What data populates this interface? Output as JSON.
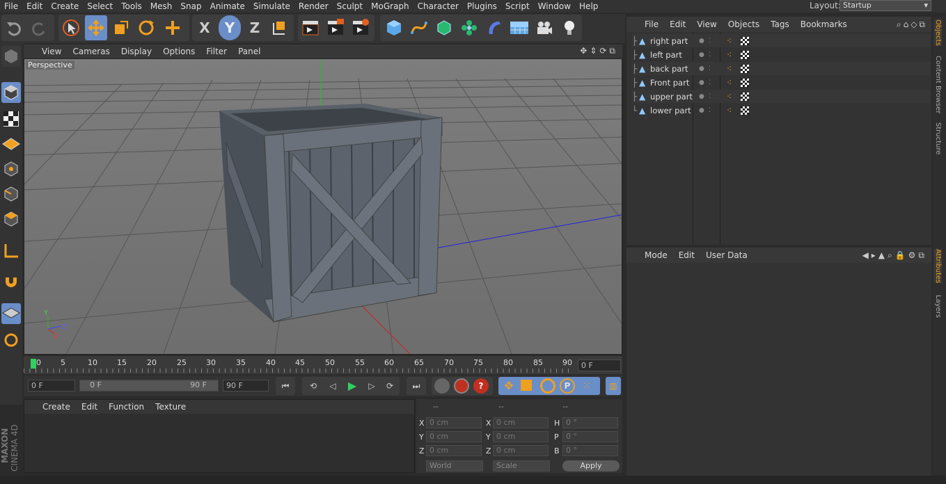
{
  "menubar": {
    "items": [
      "File",
      "Edit",
      "Create",
      "Select",
      "Tools",
      "Mesh",
      "Snap",
      "Animate",
      "Simulate",
      "Render",
      "Sculpt",
      "MoGraph",
      "Character",
      "Plugins",
      "Script",
      "Window",
      "Help"
    ],
    "layout_label": "Layout:",
    "layout_value": "Startup"
  },
  "toolbar": {
    "axis_x": "X",
    "axis_y": "Y",
    "axis_z": "Z"
  },
  "viewport": {
    "menu": [
      "View",
      "Cameras",
      "Display",
      "Options",
      "Filter",
      "Panel"
    ],
    "label": "Perspective",
    "axis_y": "Y",
    "axis_z": "Z",
    "axis_x": "X"
  },
  "timeline": {
    "ticks": [
      "0",
      "5",
      "10",
      "15",
      "20",
      "25",
      "30",
      "35",
      "40",
      "45",
      "50",
      "55",
      "60",
      "65",
      "70",
      "75",
      "80",
      "85",
      "90"
    ],
    "current_frame": "0 F"
  },
  "transport": {
    "start_field": "0 F",
    "range_start": "0 F",
    "range_end": "90 F",
    "end_field": "90 F"
  },
  "material_manager": {
    "menu": [
      "Create",
      "Edit",
      "Function",
      "Texture"
    ]
  },
  "coordinates": {
    "headers": [
      "--",
      "--",
      "--"
    ],
    "rows": [
      {
        "l1": "X",
        "v1": "0 cm",
        "l2": "X",
        "v2": "0 cm",
        "l3": "H",
        "v3": "0 °"
      },
      {
        "l1": "Y",
        "v1": "0 cm",
        "l2": "Y",
        "v2": "0 cm",
        "l3": "P",
        "v3": "0 °"
      },
      {
        "l1": "Z",
        "v1": "0 cm",
        "l2": "Z",
        "v2": "0 cm",
        "l3": "B",
        "v3": "0 °"
      }
    ],
    "world_select": "World",
    "scale_select": "Scale",
    "apply_label": "Apply"
  },
  "object_manager": {
    "menu": [
      "File",
      "Edit",
      "View",
      "Objects",
      "Tags",
      "Bookmarks"
    ],
    "objects": [
      {
        "name": "right part"
      },
      {
        "name": "left part"
      },
      {
        "name": "back part"
      },
      {
        "name": "Front part"
      },
      {
        "name": "upper part"
      },
      {
        "name": "lower part"
      }
    ]
  },
  "attribute_manager": {
    "menu": [
      "Mode",
      "Edit",
      "User Data"
    ]
  },
  "right_tabs": {
    "objects": "Objects",
    "content_browser": "Content Browser",
    "structure": "Structure",
    "attributes": "Attributes",
    "layers": "Layers"
  },
  "brand": {
    "maxon": "MAXON",
    "product": "CINEMA 4D"
  },
  "colors": {
    "accent": "#f0a020",
    "active_blue": "#6a8ec8",
    "play_green": "#30d060"
  }
}
